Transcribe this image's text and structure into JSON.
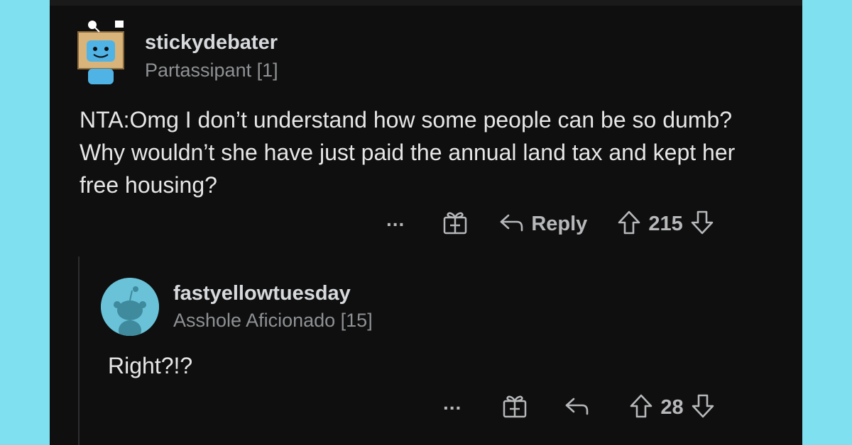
{
  "comment": {
    "username": "stickydebater",
    "flair": "Partassipant [1]",
    "body": "NTA:Omg I don’t understand how some people can be so dumb? Why wouldn’t she have just paid the annual land tax and kept her free housing?",
    "actions": {
      "more_label": "...",
      "reply_label": "Reply",
      "score": "215"
    }
  },
  "reply": {
    "username": "fastyellowtuesday",
    "flair": "Asshole Aficionado [15]",
    "body": "Right?!?",
    "actions": {
      "more_label": "...",
      "score": "28"
    }
  },
  "colors": {
    "background": "#0f0f10",
    "frame": "#7fe1ef",
    "text": "#e6e6e7",
    "muted": "#8e9193"
  },
  "icons": [
    "more-icon",
    "award-gift-icon",
    "reply-arrow-icon",
    "upvote-arrow-icon",
    "downvote-arrow-icon"
  ]
}
